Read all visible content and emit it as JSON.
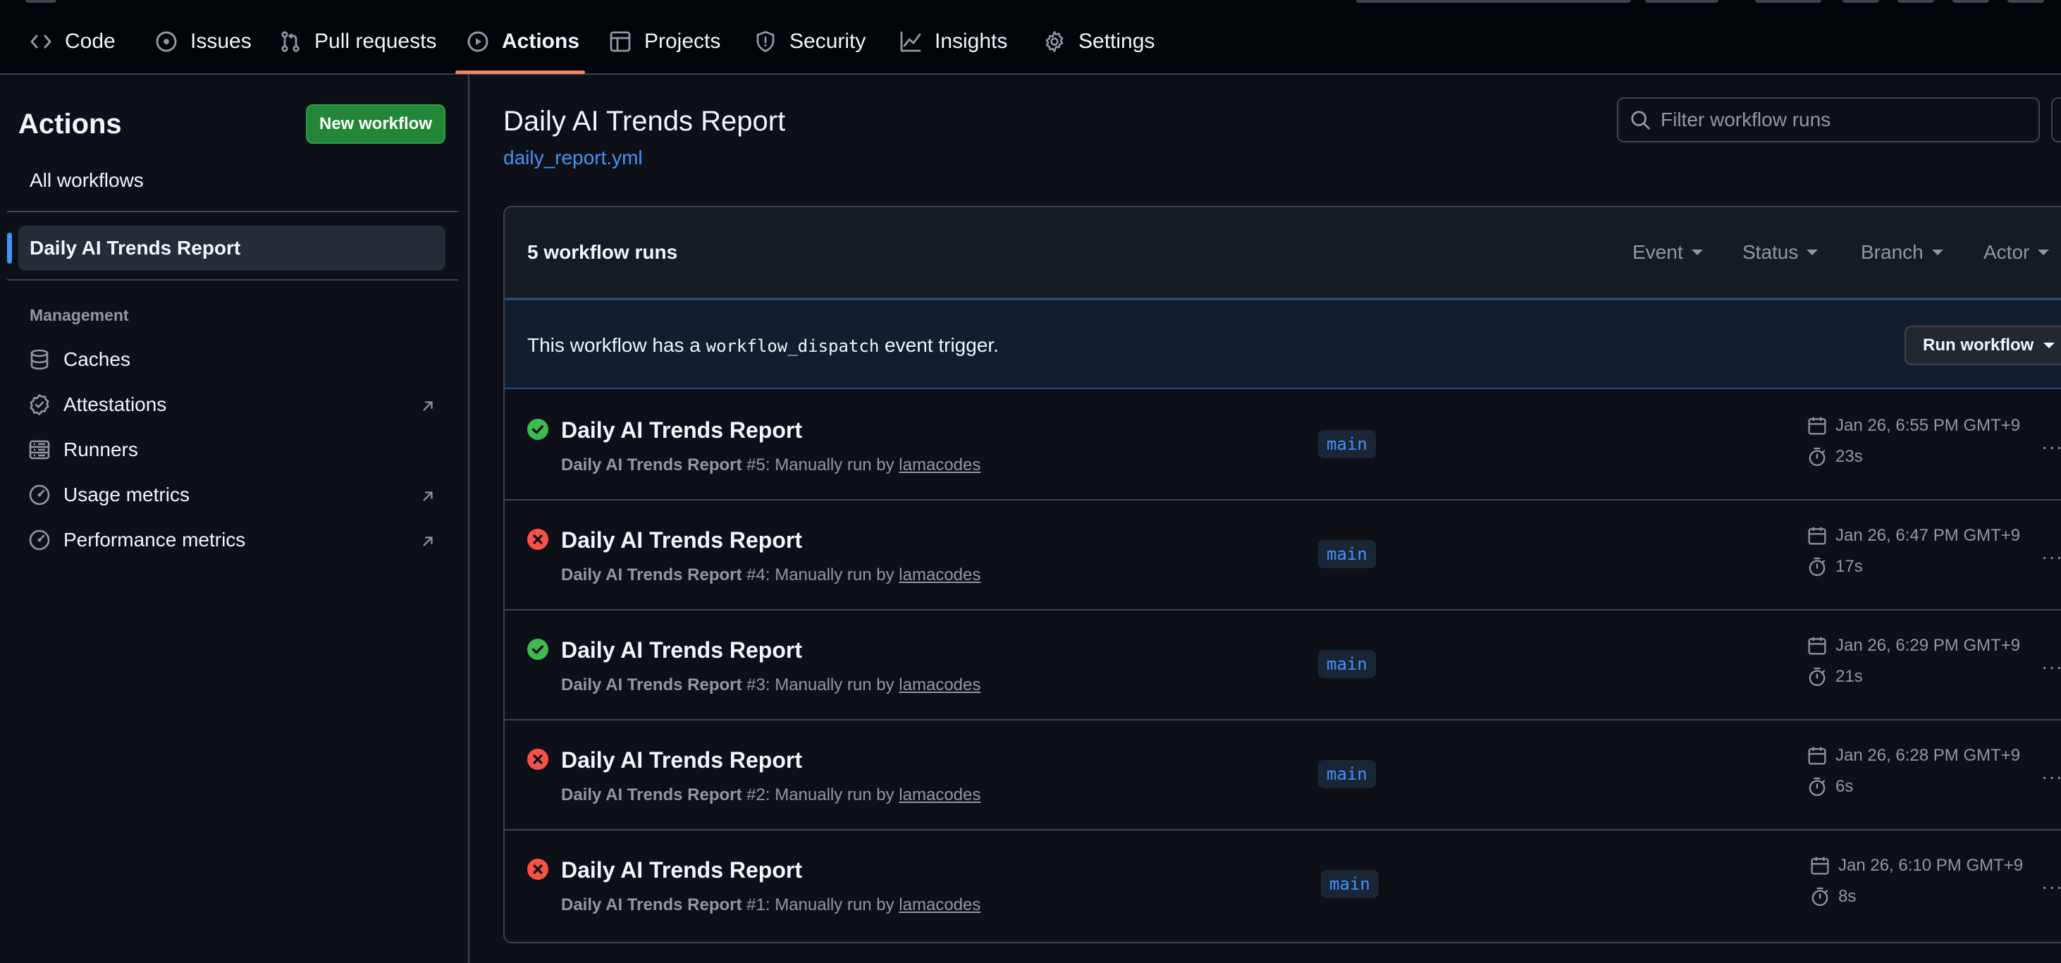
{
  "nav": {
    "tabs": [
      {
        "label": "Code",
        "icon": "code-icon"
      },
      {
        "label": "Issues",
        "icon": "issue-icon"
      },
      {
        "label": "Pull requests",
        "icon": "pull-request-icon"
      },
      {
        "label": "Actions",
        "icon": "play-icon",
        "active": true
      },
      {
        "label": "Projects",
        "icon": "table-icon"
      },
      {
        "label": "Security",
        "icon": "shield-icon"
      },
      {
        "label": "Insights",
        "icon": "graph-icon"
      },
      {
        "label": "Settings",
        "icon": "gear-icon"
      }
    ]
  },
  "sidebar": {
    "title": "Actions",
    "new_workflow_label": "New workflow",
    "all_workflows_label": "All workflows",
    "selected_workflow": "Daily AI Trends Report",
    "section_label": "Management",
    "items": [
      {
        "label": "Caches",
        "icon": "database-icon",
        "external": false
      },
      {
        "label": "Attestations",
        "icon": "verified-icon",
        "external": true
      },
      {
        "label": "Runners",
        "icon": "server-icon",
        "external": false
      },
      {
        "label": "Usage metrics",
        "icon": "meter-icon",
        "external": true
      },
      {
        "label": "Performance metrics",
        "icon": "meter-icon",
        "external": true
      }
    ]
  },
  "main": {
    "title": "Daily AI Trends Report",
    "file": "daily_report.yml",
    "filter_placeholder": "Filter workflow runs",
    "runs_count": "5 workflow runs",
    "filters": [
      "Event",
      "Status",
      "Branch",
      "Actor"
    ],
    "dispatch": {
      "prefix": "This workflow has a ",
      "code": "workflow_dispatch",
      "suffix": " event trigger."
    },
    "run_workflow_label": "Run workflow",
    "runs": [
      {
        "status": "success",
        "title": "Daily AI Trends Report",
        "workflow": "Daily AI Trends Report",
        "number": "#5",
        "trigger": ": Manually run by ",
        "actor": "lamacodes",
        "branch": "main",
        "date": "Jan 26, 6:55 PM GMT+9",
        "duration": "23s"
      },
      {
        "status": "failure",
        "title": "Daily AI Trends Report",
        "workflow": "Daily AI Trends Report",
        "number": "#4",
        "trigger": ": Manually run by ",
        "actor": "lamacodes",
        "branch": "main",
        "date": "Jan 26, 6:47 PM GMT+9",
        "duration": "17s"
      },
      {
        "status": "success",
        "title": "Daily AI Trends Report",
        "workflow": "Daily AI Trends Report",
        "number": "#3",
        "trigger": ": Manually run by ",
        "actor": "lamacodes",
        "branch": "main",
        "date": "Jan 26, 6:29 PM GMT+9",
        "duration": "21s"
      },
      {
        "status": "failure",
        "title": "Daily AI Trends Report",
        "workflow": "Daily AI Trends Report",
        "number": "#2",
        "trigger": ": Manually run by ",
        "actor": "lamacodes",
        "branch": "main",
        "date": "Jan 26, 6:28 PM GMT+9",
        "duration": "6s"
      },
      {
        "status": "failure",
        "title": "Daily AI Trends Report",
        "workflow": "Daily AI Trends Report",
        "number": "#1",
        "trigger": ": Manually run by ",
        "actor": "lamacodes",
        "branch": "main",
        "date": "Jan 26, 6:10 PM GMT+9",
        "duration": "8s"
      }
    ]
  },
  "colors": {
    "background": "#0d1117",
    "nav_background": "#010409",
    "accent_link": "#4493f8",
    "tab_underline": "#f78166",
    "success": "#3fb950",
    "failure": "#f85149",
    "primary_button": "#238636"
  }
}
